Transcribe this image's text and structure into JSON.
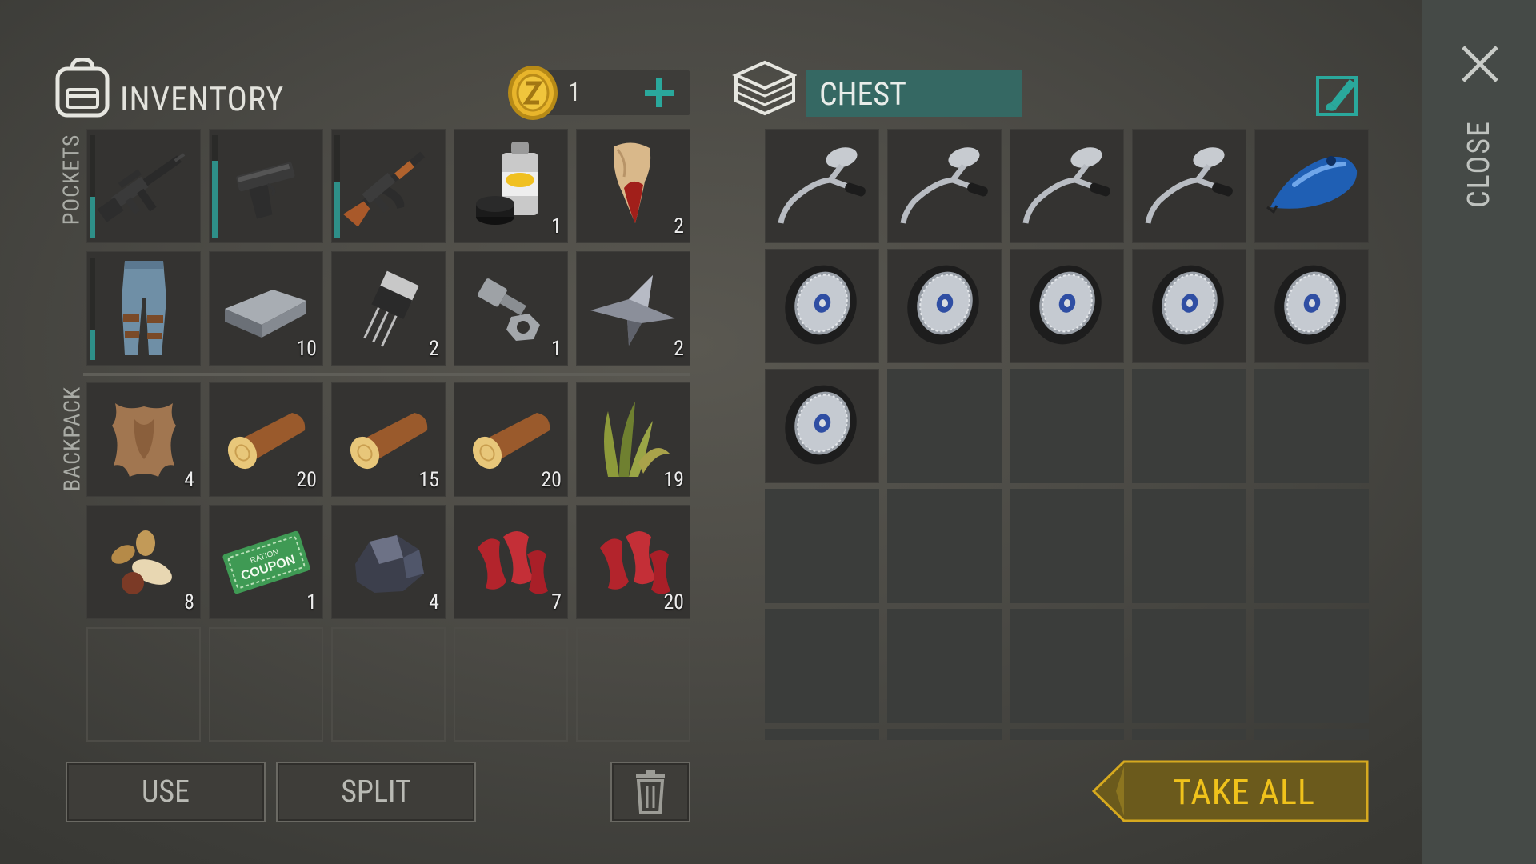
{
  "inventory": {
    "title": "INVENTORY",
    "coins": "1",
    "pockets_label": "POCKETS",
    "backpack_label": "BACKPACK",
    "pockets": [
      {
        "item": "assault-rifle",
        "qty": "",
        "durability": 0.4
      },
      {
        "item": "pistol",
        "qty": "",
        "durability": 0.75
      },
      {
        "item": "ak-rifle",
        "qty": "",
        "durability": 0.55
      },
      {
        "item": "aerosol-paint",
        "qty": "1"
      },
      {
        "item": "bloody-fang",
        "qty": "2"
      },
      {
        "item": "jeans",
        "qty": "",
        "durability": 0.3
      },
      {
        "item": "iron-ingot",
        "qty": "10"
      },
      {
        "item": "transistor",
        "qty": "2"
      },
      {
        "item": "bolt-and-nut",
        "qty": "1"
      },
      {
        "item": "metal-scraps",
        "qty": "2"
      }
    ],
    "backpack": [
      {
        "item": "animal-hide",
        "qty": "4"
      },
      {
        "item": "log",
        "qty": "20"
      },
      {
        "item": "log",
        "qty": "15"
      },
      {
        "item": "log",
        "qty": "20"
      },
      {
        "item": "plant-fiber",
        "qty": "19"
      },
      {
        "item": "seeds",
        "qty": "8"
      },
      {
        "item": "ration-coupon",
        "qty": "1",
        "text1": "RATION",
        "text2": "COUPON"
      },
      {
        "item": "coal-ore",
        "qty": "4"
      },
      {
        "item": "raw-meat",
        "qty": "7"
      },
      {
        "item": "raw-meat",
        "qty": "20"
      }
    ]
  },
  "chest": {
    "name": "CHEST",
    "items": [
      {
        "item": "handlebar"
      },
      {
        "item": "handlebar"
      },
      {
        "item": "handlebar"
      },
      {
        "item": "handlebar"
      },
      {
        "item": "fuel-tank"
      },
      {
        "item": "wheel"
      },
      {
        "item": "wheel"
      },
      {
        "item": "wheel"
      },
      {
        "item": "wheel"
      },
      {
        "item": "wheel"
      },
      {
        "item": "wheel"
      }
    ]
  },
  "buttons": {
    "use": "USE",
    "split": "SPLIT",
    "take_all": "TAKE ALL",
    "close": "CLOSE"
  },
  "colors": {
    "accent_teal": "#2e8f88",
    "take_all_gold": "#f0c21b",
    "take_all_bg": "#6b5a1c"
  }
}
